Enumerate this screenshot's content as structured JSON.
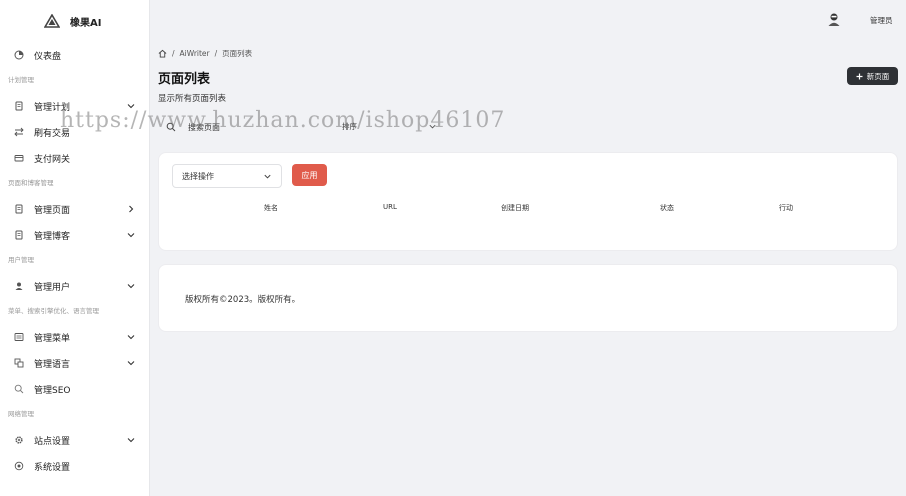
{
  "brand": {
    "name": "橡果AI"
  },
  "sidebar": {
    "items": [
      {
        "type": "item",
        "label": "仪表盘",
        "icon": "dashboard-icon",
        "chevron": ""
      },
      {
        "type": "section",
        "label": "计划管理"
      },
      {
        "type": "item",
        "label": "管理计划",
        "icon": "document-icon",
        "chevron": "down"
      },
      {
        "type": "item",
        "label": "刷有交易",
        "icon": "transactions-icon",
        "chevron": ""
      },
      {
        "type": "item",
        "label": "支付网关",
        "icon": "card-icon",
        "chevron": ""
      },
      {
        "type": "section",
        "label": "页面和博客管理"
      },
      {
        "type": "item",
        "label": "管理页面",
        "icon": "document-icon",
        "chevron": "right"
      },
      {
        "type": "item",
        "label": "管理博客",
        "icon": "document-icon",
        "chevron": "down"
      },
      {
        "type": "section",
        "label": "用户管理"
      },
      {
        "type": "item",
        "label": "管理用户",
        "icon": "user-icon",
        "chevron": "down"
      },
      {
        "type": "section",
        "label": "菜单、搜索引擎优化、语言管理"
      },
      {
        "type": "item",
        "label": "管理菜单",
        "icon": "menu-icon",
        "chevron": "down"
      },
      {
        "type": "item",
        "label": "管理语言",
        "icon": "language-icon",
        "chevron": "down"
      },
      {
        "type": "item",
        "label": "管理SEO",
        "icon": "search-icon",
        "chevron": ""
      },
      {
        "type": "section",
        "label": "网络管理"
      },
      {
        "type": "item",
        "label": "站点设置",
        "icon": "gear-icon",
        "chevron": "down"
      },
      {
        "type": "item",
        "label": "系统设置",
        "icon": "system-icon",
        "chevron": ""
      }
    ]
  },
  "topbar": {
    "admin_name": "管理员"
  },
  "breadcrumb": {
    "items": [
      "AiWriter",
      "页面列表"
    ],
    "separator": "/"
  },
  "page": {
    "title": "页面列表",
    "subtitle": "显示所有页面列表",
    "new_button": "新页面"
  },
  "filters": {
    "search_value": "搜索页面",
    "sort_label": "排序"
  },
  "table": {
    "action_select": "选择操作",
    "apply_button": "应用",
    "headers": [
      "姓名",
      "URL",
      "创建日期",
      "状态",
      "行动"
    ]
  },
  "footer": {
    "copyright": "版权所有©2023。版权所有。"
  },
  "watermark": "https://www.huzhan.com/ishop46107",
  "colors": {
    "accent": "#e05b4b",
    "dark_button": "#2e3135",
    "background": "#f1f2f5"
  }
}
